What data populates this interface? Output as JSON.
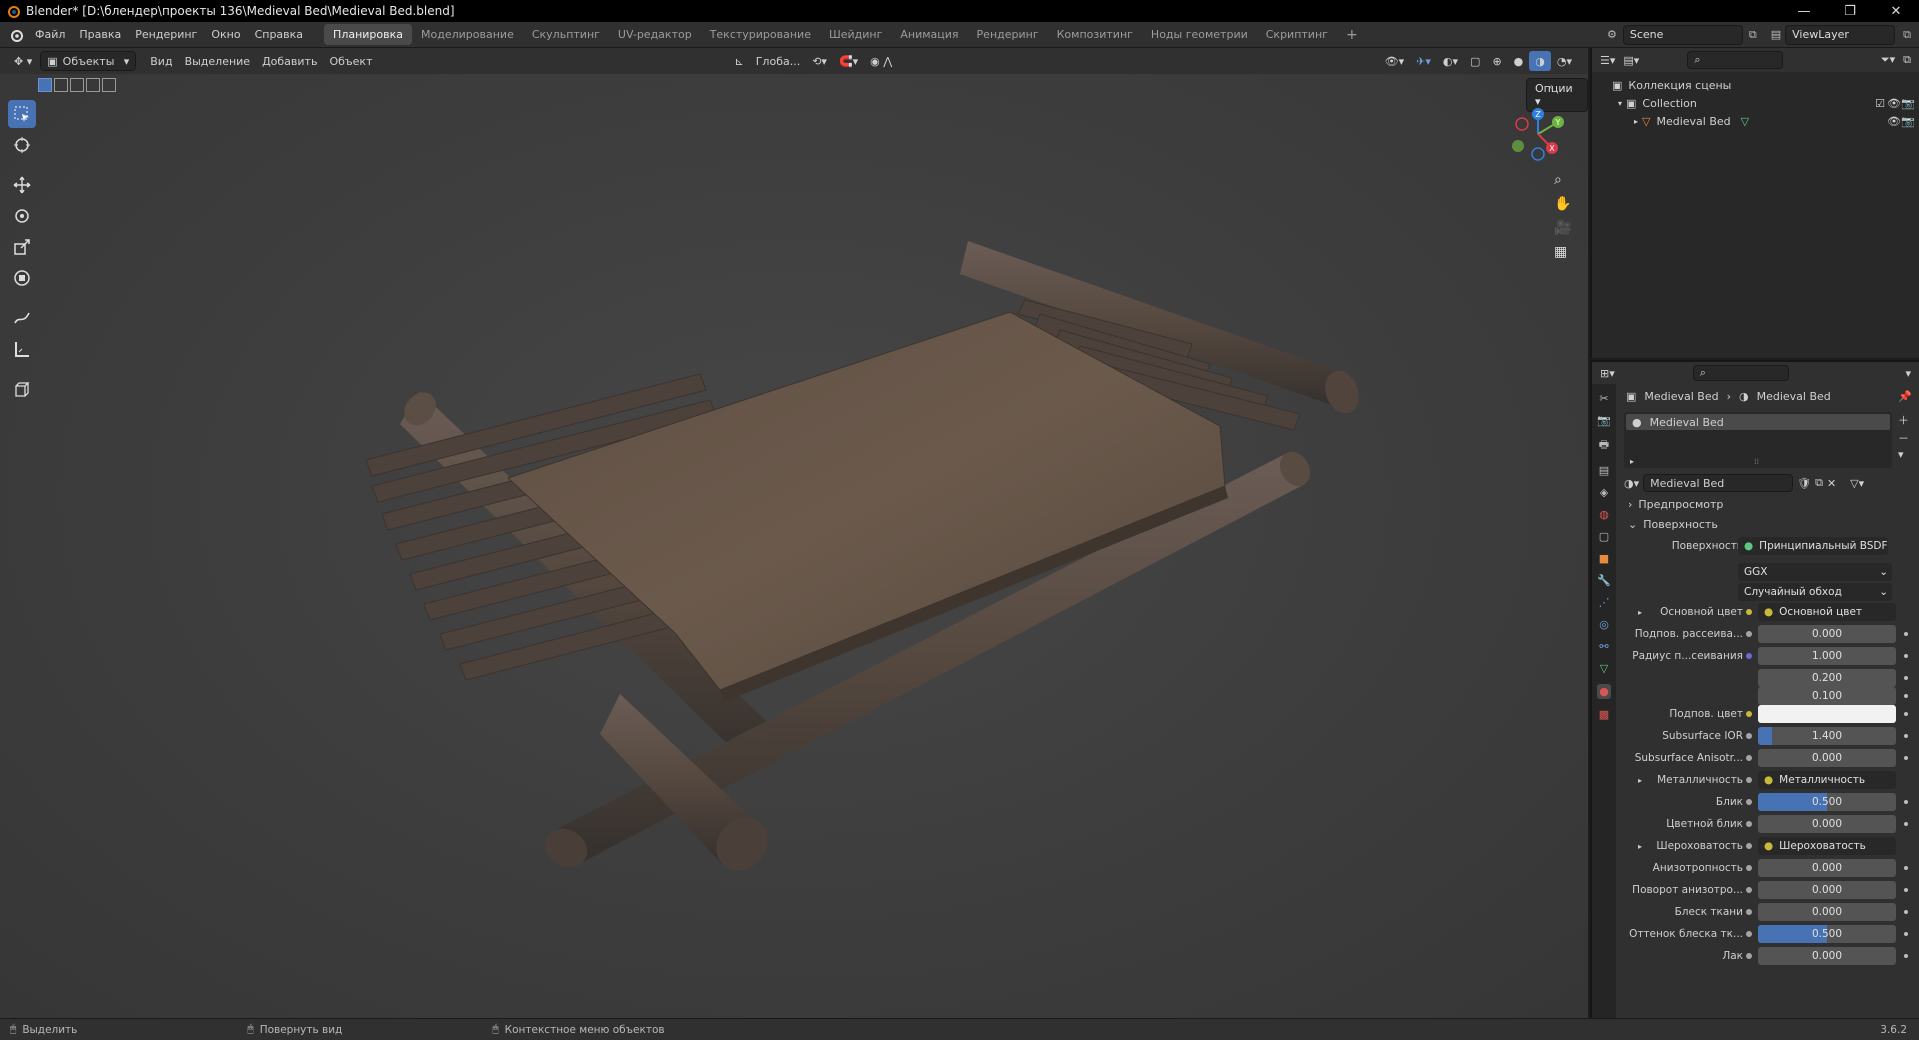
{
  "window": {
    "title": "Blender* [D:\\блендер\\проекты 136\\Medieval Bed\\Medieval Bed.blend]",
    "controls": [
      "—",
      "❐",
      "✕"
    ]
  },
  "menu": {
    "items": [
      "Файл",
      "Правка",
      "Рендеринг",
      "Окно",
      "Справка"
    ],
    "workspaces": [
      "Планировка",
      "Моделирование",
      "Скульптинг",
      "UV-редактор",
      "Текстурирование",
      "Шейдинг",
      "Анимация",
      "Рендеринг",
      "Композитинг",
      "Ноды геометрии",
      "Скриптинг"
    ],
    "active_workspace": 0,
    "add_tab": "+",
    "scene": "Scene",
    "view_layer": "ViewLayer"
  },
  "viewport_header": {
    "mode": "Объекты",
    "menus": [
      "Вид",
      "Выделение",
      "Добавить",
      "Объект"
    ],
    "orientation": "Глоба...",
    "options": "Опции"
  },
  "gizmo": {
    "x": "X",
    "y": "Y",
    "z": "Z"
  },
  "outliner": {
    "scene_collection": "Коллекция сцены",
    "collection": "Collection",
    "object": "Medieval Bed"
  },
  "properties": {
    "breadcrumb": [
      "Medieval Bed",
      "Medieval Bed"
    ],
    "material_slot": "Medieval Bed",
    "material_name": "Medieval Bed",
    "panels": {
      "preview": "Предпросмотр",
      "surface": "Поверхность"
    },
    "surface_label": "Поверхность",
    "surface_value": "Принципиальный BSDF",
    "distribution": "GGX",
    "subsurface_method": "Случайный обход",
    "rows": [
      {
        "label": "Основной цвет",
        "value": "Основной цвет",
        "type": "link",
        "dot": "#c8b93a",
        "expand": true
      },
      {
        "label": "Подпов. рассеива...",
        "value": "0.000",
        "type": "num",
        "fill": 0
      },
      {
        "label": "Радиус п...сеивания",
        "value": "1.000",
        "type": "num",
        "fill": 0,
        "dot": "#6a6ad8"
      },
      {
        "label": "",
        "value": "0.200",
        "type": "num",
        "fill": 0,
        "nodot": true
      },
      {
        "label": "",
        "value": "0.100",
        "type": "num",
        "fill": 0,
        "nodot": true
      },
      {
        "label": "Подпов. цвет",
        "value": "",
        "type": "color",
        "dot": "#c8b93a"
      },
      {
        "label": "Subsurface IOR",
        "value": "1.400",
        "type": "num",
        "fill": 0.1
      },
      {
        "label": "Subsurface Anisotr...",
        "value": "0.000",
        "type": "num",
        "fill": 0
      },
      {
        "label": "Металличность",
        "value": "Металличность",
        "type": "link",
        "expand": true
      },
      {
        "label": "Блик",
        "value": "0.500",
        "type": "num",
        "fill": 0.5
      },
      {
        "label": "Цветной блик",
        "value": "0.000",
        "type": "num",
        "fill": 0
      },
      {
        "label": "Шероховатость",
        "value": "Шероховатость",
        "type": "link",
        "expand": true
      },
      {
        "label": "Анизотропность",
        "value": "0.000",
        "type": "num",
        "fill": 0
      },
      {
        "label": "Поворот анизотро...",
        "value": "0.000",
        "type": "num",
        "fill": 0
      },
      {
        "label": "Блеск ткани",
        "value": "0.000",
        "type": "num",
        "fill": 0
      },
      {
        "label": "Оттенок блеска тк...",
        "value": "0.500",
        "type": "num",
        "fill": 0.5
      },
      {
        "label": "Лак",
        "value": "0.000",
        "type": "num",
        "fill": 0
      }
    ]
  },
  "statusbar": {
    "items": [
      "Выделить",
      "Повернуть вид",
      "Контекстное меню объектов"
    ],
    "version": "3.6.2"
  }
}
